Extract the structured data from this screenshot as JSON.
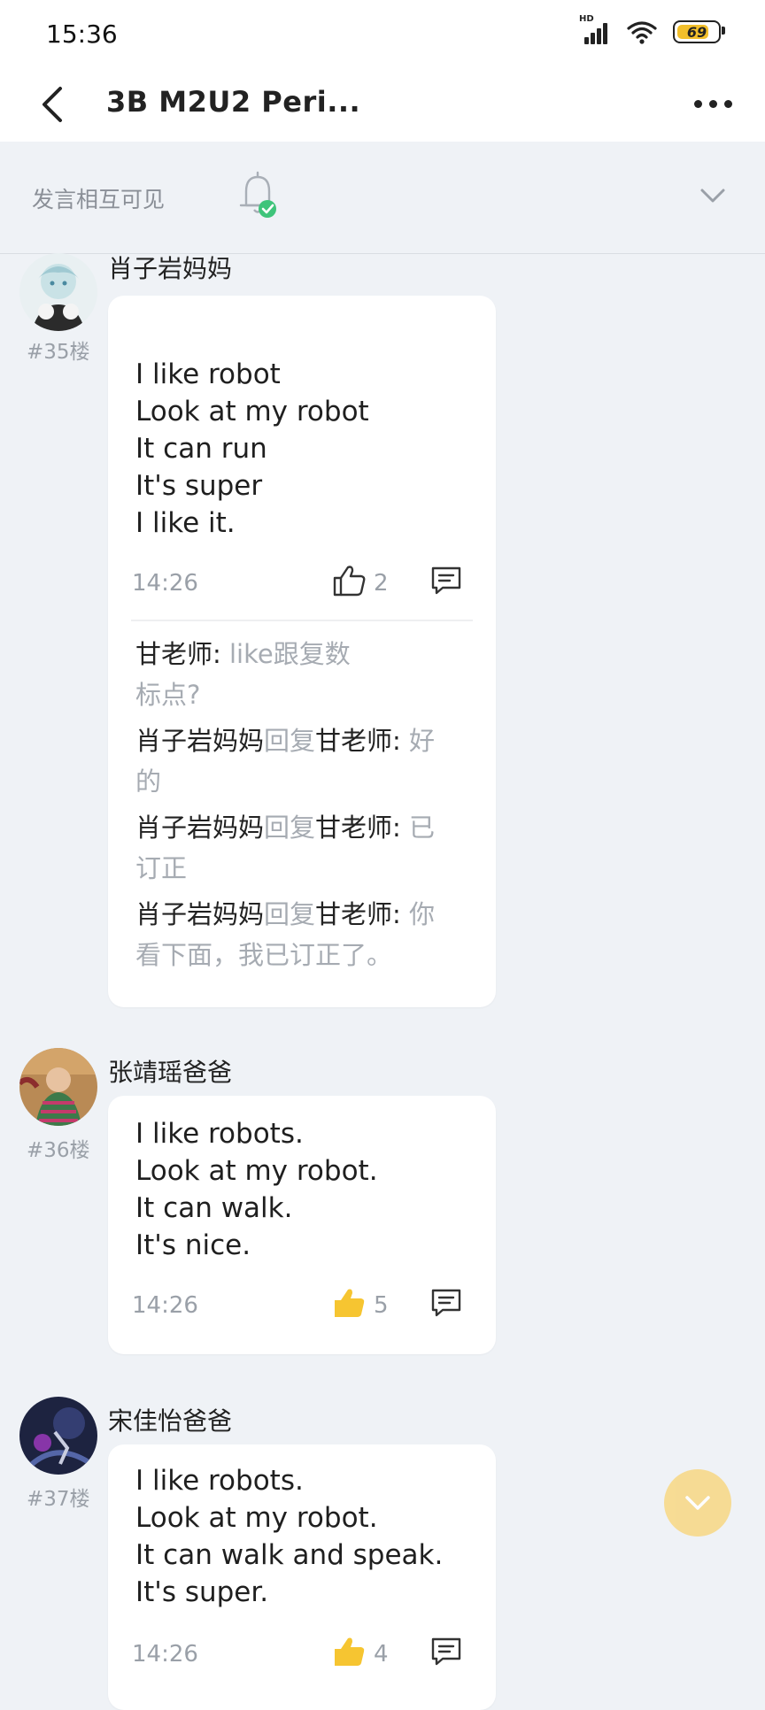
{
  "status": {
    "time": "15:36",
    "hd": "HD",
    "battery": "69"
  },
  "nav": {
    "title": "3B M2U2 Peri..."
  },
  "filter": {
    "label": "发言相互可见"
  },
  "posts": [
    {
      "author": "肖子岩妈妈",
      "floor": "#35楼",
      "lines": [
        "I like robot",
        "Look at my robot",
        "It can run",
        "It's super",
        "I like it."
      ],
      "time": "14:26",
      "likes": "2",
      "replies": [
        {
          "name": "甘老师:",
          "text1": " like跟复数",
          "text2": "标点?"
        },
        {
          "name": "肖子岩妈妈",
          "verb": "回复",
          "target": "甘老师:",
          "text1": " 好",
          "text2": "的"
        },
        {
          "name": "肖子岩妈妈",
          "verb": "回复",
          "target": "甘老师:",
          "text1": " 已",
          "text2": "订正"
        },
        {
          "name": "肖子岩妈妈",
          "verb": "回复",
          "target": "甘老师:",
          "text1": " 你",
          "text2": "看下面，我已订正了。"
        }
      ]
    },
    {
      "author": "张靖瑶爸爸",
      "floor": "#36楼",
      "lines": [
        "I like robots.",
        "Look at my robot.",
        "It can walk.",
        "It's nice."
      ],
      "time": "14:26",
      "likes": "5"
    },
    {
      "author": "宋佳怡爸爸",
      "floor": "#37楼",
      "lines": [
        "I like robots.",
        "Look at my robot.",
        "It can walk and speak.",
        "It's super."
      ],
      "time": "14:26",
      "likes": "4"
    }
  ],
  "colors": {
    "accent": "#f2bf2b",
    "muted": "#9aa0a8",
    "background": "#eff2f6",
    "card": "#ffffff"
  },
  "icons": [
    "back-icon",
    "more-icon",
    "bell-icon",
    "chevron-down-icon",
    "thumbs-up-icon",
    "comment-icon"
  ]
}
